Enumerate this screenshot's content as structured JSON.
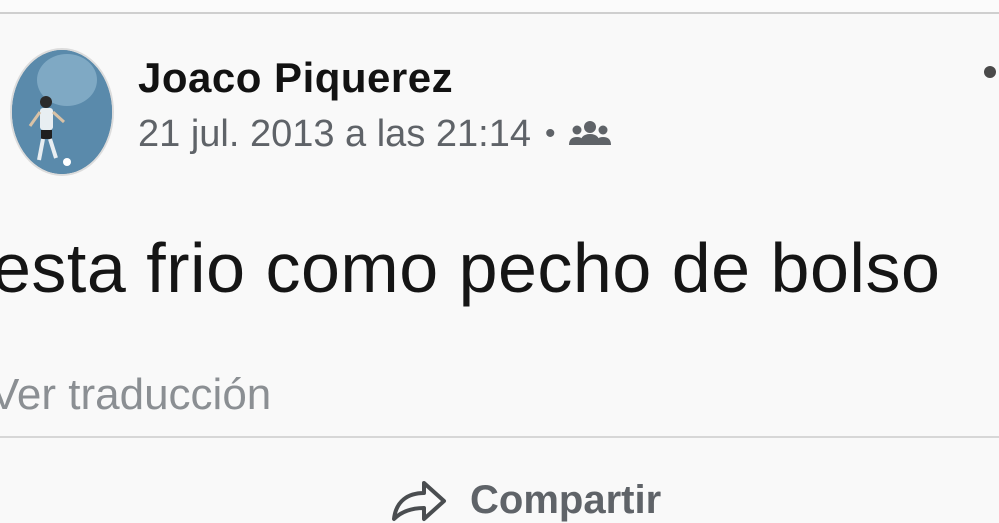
{
  "post": {
    "author": "Joaco Piquerez",
    "timestamp": "21 jul. 2013 a las 21:14",
    "separator": "•",
    "audience_icon": "friends-icon",
    "text": "esta frio como pecho de bolso",
    "translate_label": "Ver traducción",
    "more_icon": "more-options-icon"
  },
  "actions": {
    "share_label": "Compartir",
    "share_icon": "share-arrow-icon"
  },
  "colors": {
    "meta_gray": "#5f6368",
    "translate_gray": "#8b8f93",
    "text_black": "#151515"
  }
}
